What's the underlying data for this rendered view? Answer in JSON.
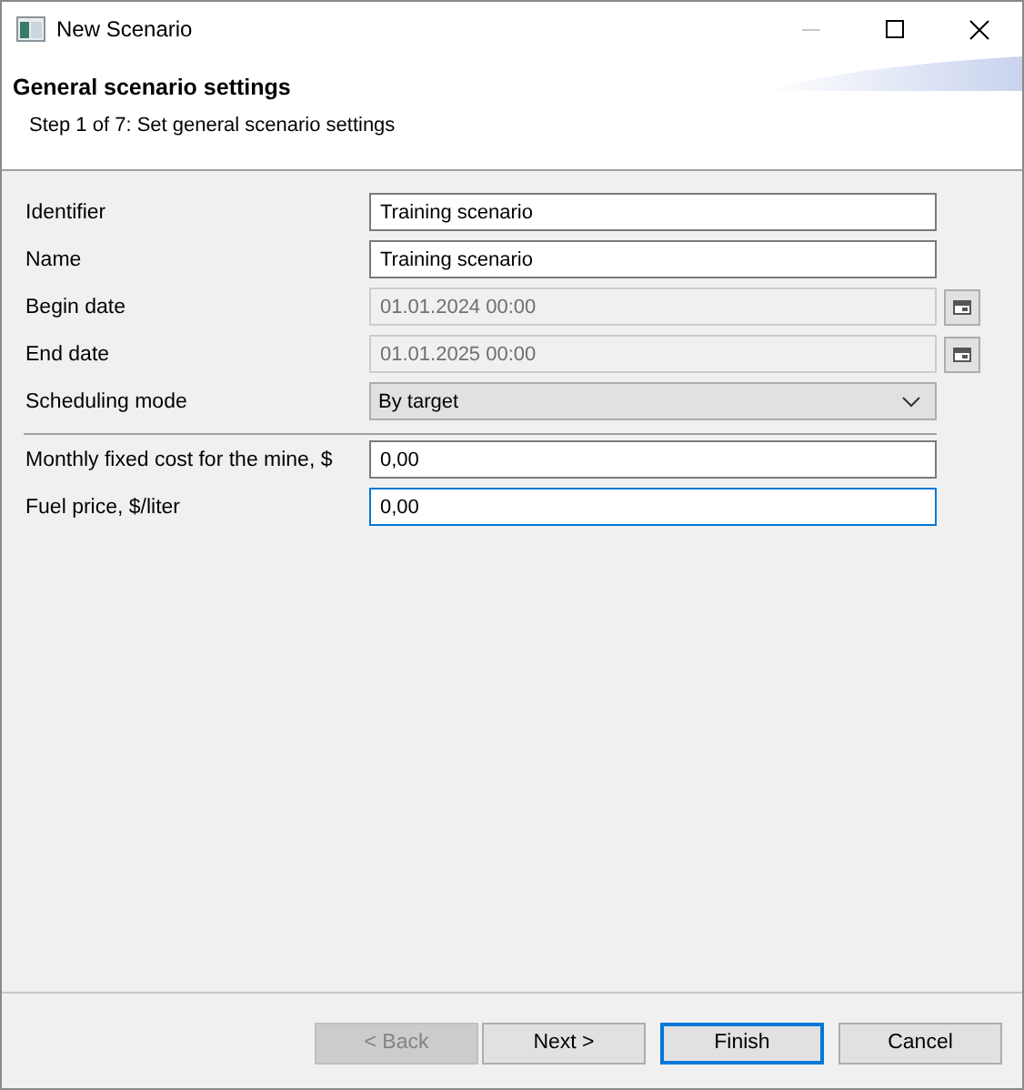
{
  "window": {
    "title": "New Scenario"
  },
  "header": {
    "title": "General scenario settings",
    "subtitle": "Step 1 of 7: Set general scenario settings"
  },
  "field_groups": [
    {
      "fields": [
        {
          "label": "Identifier",
          "kind": "text",
          "value": "Training scenario",
          "disabled": false,
          "focused": false
        },
        {
          "label": "Name",
          "kind": "text",
          "value": "Training scenario",
          "disabled": false,
          "focused": false
        },
        {
          "label": "Begin date",
          "kind": "date",
          "value": "01.01.2024 00:00",
          "disabled": true,
          "focused": false
        },
        {
          "label": "End date",
          "kind": "date",
          "value": "01.01.2025 00:00",
          "disabled": true,
          "focused": false
        },
        {
          "label": "Scheduling mode",
          "kind": "select",
          "value": "By target",
          "disabled": false,
          "focused": false
        }
      ]
    },
    {
      "fields": [
        {
          "label": "Monthly fixed cost for the mine, $",
          "kind": "text",
          "value": "0,00",
          "disabled": false,
          "focused": false
        },
        {
          "label": "Fuel price, $/liter",
          "kind": "text",
          "value": "0,00",
          "disabled": false,
          "focused": true
        }
      ]
    }
  ],
  "buttons": [
    {
      "label": "< Back",
      "disabled": true,
      "default": false
    },
    {
      "label": "Next >",
      "disabled": false,
      "default": false
    },
    {
      "label": "Finish",
      "disabled": false,
      "default": true
    },
    {
      "label": "Cancel",
      "disabled": false,
      "default": false
    }
  ]
}
